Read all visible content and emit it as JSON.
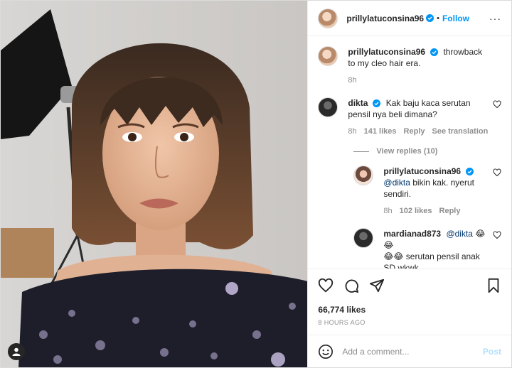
{
  "header": {
    "username": "prillylatuconsina96",
    "separator": "•",
    "follow_label": "Follow",
    "more_label": "···"
  },
  "caption": {
    "username": "prillylatuconsina96",
    "text": "throwback to my cleo hair era.",
    "time": "8h"
  },
  "comments": [
    {
      "username": "dikta",
      "text": "Kak baju kaca serutan pensil nya beli dimana?",
      "time": "8h",
      "likes": "141 likes",
      "reply_label": "Reply",
      "translate_label": "See translation"
    }
  ],
  "view_replies_label": "View replies (10)",
  "replies": [
    {
      "username": "prillylatuconsina96",
      "mention": "@dikta",
      "text": " bikin kak. nyerut sendiri.",
      "time": "8h",
      "likes": "102 likes",
      "reply_label": "Reply"
    },
    {
      "username": "mardianad873",
      "mention": "@dikta",
      "text_line1": " 😂😂",
      "text_line2": "😂😂 serutan pensil anak SD wkwk"
    }
  ],
  "likes_count": "66,774 likes",
  "timestamp": "8 HOURS AGO",
  "comment_input": {
    "placeholder": "Add a comment...",
    "post_label": "Post"
  },
  "colors": {
    "accent": "#0095f6",
    "post_disabled": "#b2dffc",
    "secondary_text": "#8e8e8e"
  }
}
